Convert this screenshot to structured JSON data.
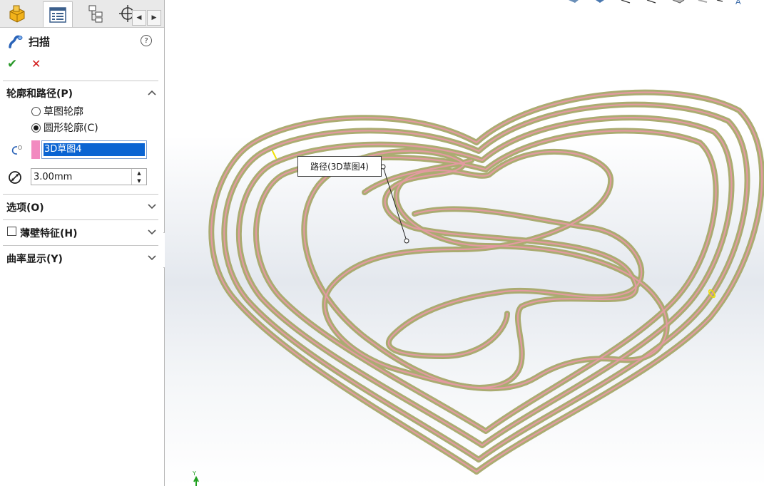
{
  "property_manager": {
    "tabs": [
      {
        "name": "featuremanager-tab",
        "icon": "part-icon"
      },
      {
        "name": "propertymanager-tab",
        "icon": "property-list-icon"
      },
      {
        "name": "configurationmanager-tab",
        "icon": "configuration-tree-icon"
      },
      {
        "name": "dimxpert-tab",
        "icon": "crosshair-icon"
      }
    ],
    "title": "扫描",
    "ok_icon": "✔",
    "cancel_icon": "✕",
    "section_profile_path": "轮廓和路径(P)",
    "radio_sketch_profile": "草图轮廓",
    "radio_circular_profile": "圆形轮廓(C)",
    "radio_selected": "circular",
    "path_value": "3D草图4",
    "diameter_value": "3.00mm",
    "section_options": "选项(O)",
    "section_thin_feature": "薄壁特征(H)",
    "section_curvature_display": "曲率显示(Y)"
  },
  "graphics": {
    "callout_label": "路径(3D草图4)",
    "triad_y_label": "Y",
    "path_color": "#f28ac0",
    "sweep_color": "#a7a86a"
  },
  "colors": {
    "selection": "#0a64d2",
    "ok": "#2c9a2c",
    "cancel": "#d21b1b"
  }
}
